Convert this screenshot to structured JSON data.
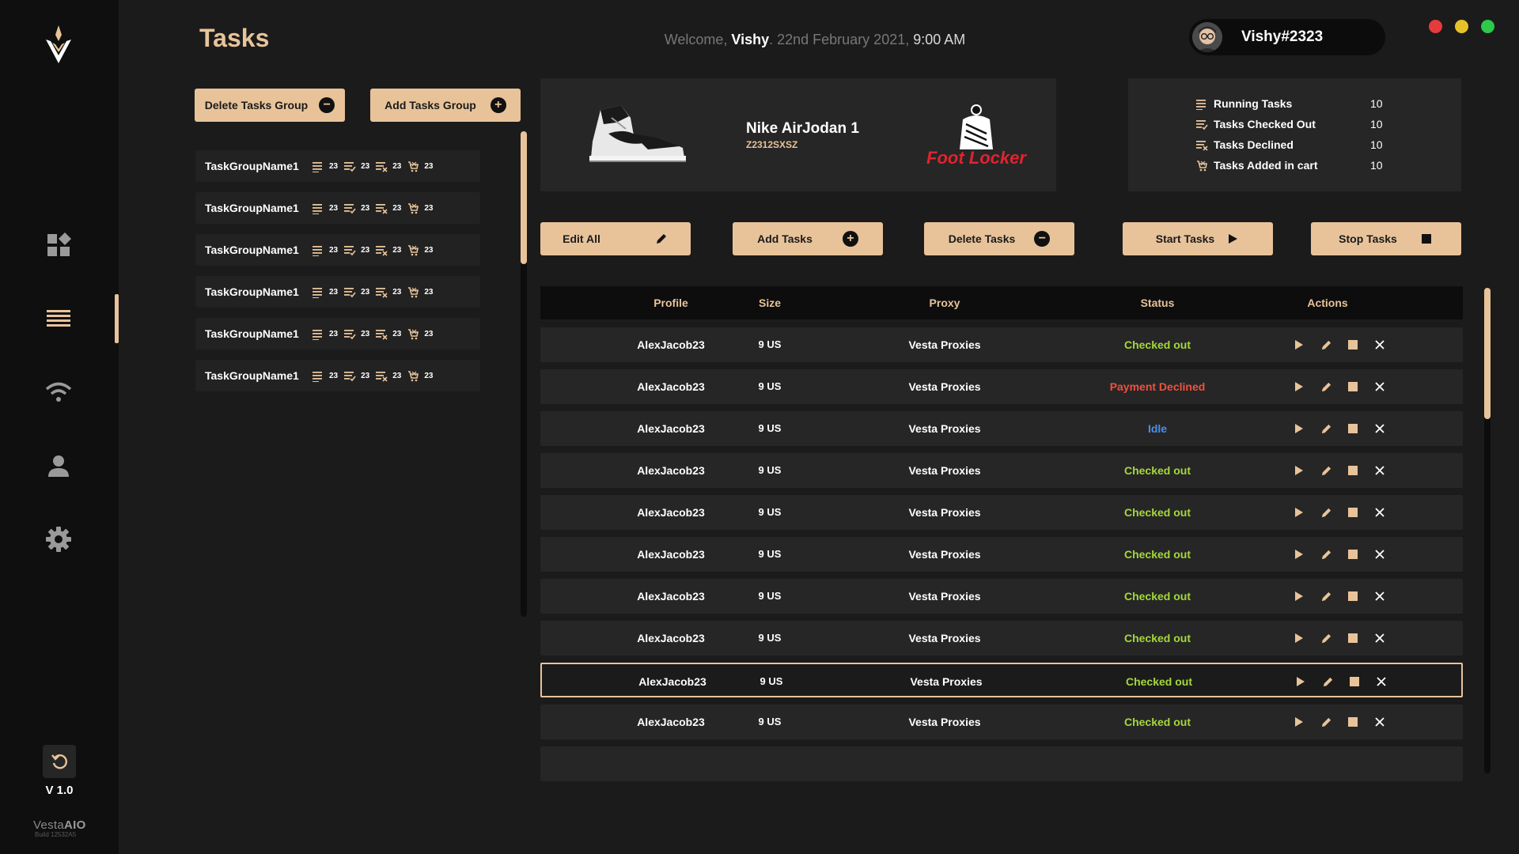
{
  "sidebar": {
    "nav": [
      "dashboard-icon",
      "tasks-icon",
      "proxies-icon",
      "profiles-icon",
      "settings-icon"
    ],
    "active": "tasks-icon",
    "version": "V 1.0",
    "brand_light": "Vesta",
    "brand_bold": "AIO",
    "build": "Build 12532A5"
  },
  "header": {
    "title": "Tasks",
    "welcome_prefix": "Welcome, ",
    "welcome_name": "Vishy",
    "welcome_date": ". 22nd February 2021, ",
    "welcome_time": "9:00 AM",
    "username": "Vishy#2323"
  },
  "window_controls": {
    "close": "#e63b3b",
    "minimize": "#e6c229",
    "maximize": "#2ec84a"
  },
  "group_buttons": {
    "delete": "Delete Tasks Group",
    "add": "Add Tasks Group"
  },
  "task_groups": [
    {
      "name": "TaskGroupName1",
      "running": "23",
      "checked": "23",
      "declined": "23",
      "cart": "23"
    },
    {
      "name": "TaskGroupName1",
      "running": "23",
      "checked": "23",
      "declined": "23",
      "cart": "23"
    },
    {
      "name": "TaskGroupName1",
      "running": "23",
      "checked": "23",
      "declined": "23",
      "cart": "23"
    },
    {
      "name": "TaskGroupName1",
      "running": "23",
      "checked": "23",
      "declined": "23",
      "cart": "23"
    },
    {
      "name": "TaskGroupName1",
      "running": "23",
      "checked": "23",
      "declined": "23",
      "cart": "23"
    },
    {
      "name": "TaskGroupName1",
      "running": "23",
      "checked": "23",
      "declined": "23",
      "cart": "23"
    }
  ],
  "product": {
    "name": "Nike AirJodan 1",
    "sku": "Z2312SXSZ",
    "store": "Foot Locker"
  },
  "stats": [
    {
      "label": "Running Tasks",
      "value": "10",
      "icon": "running-icon"
    },
    {
      "label": "Tasks Checked Out",
      "value": "10",
      "icon": "checked-icon"
    },
    {
      "label": "Tasks Declined",
      "value": "10",
      "icon": "declined-icon"
    },
    {
      "label": "Tasks Added in cart",
      "value": "10",
      "icon": "cart-icon"
    }
  ],
  "toolbar": {
    "edit_all": "Edit All",
    "add_tasks": "Add Tasks",
    "delete_tasks": "Delete Tasks",
    "start_tasks": "Start Tasks",
    "stop_tasks": "Stop Tasks"
  },
  "table": {
    "headers": {
      "profile": "Profile",
      "size": "Size",
      "proxy": "Proxy",
      "status": "Status",
      "actions": "Actions"
    },
    "rows": [
      {
        "profile": "AlexJacob23",
        "size": "9 US",
        "proxy": "Vesta Proxies",
        "status": "Checked out",
        "state": "ok"
      },
      {
        "profile": "AlexJacob23",
        "size": "9 US",
        "proxy": "Vesta Proxies",
        "status": "Payment Declined",
        "state": "dec"
      },
      {
        "profile": "AlexJacob23",
        "size": "9 US",
        "proxy": "Vesta Proxies",
        "status": "Idle",
        "state": "idle"
      },
      {
        "profile": "AlexJacob23",
        "size": "9 US",
        "proxy": "Vesta Proxies",
        "status": "Checked out",
        "state": "ok"
      },
      {
        "profile": "AlexJacob23",
        "size": "9 US",
        "proxy": "Vesta Proxies",
        "status": "Checked out",
        "state": "ok"
      },
      {
        "profile": "AlexJacob23",
        "size": "9 US",
        "proxy": "Vesta Proxies",
        "status": "Checked out",
        "state": "ok"
      },
      {
        "profile": "AlexJacob23",
        "size": "9 US",
        "proxy": "Vesta Proxies",
        "status": "Checked out",
        "state": "ok"
      },
      {
        "profile": "AlexJacob23",
        "size": "9 US",
        "proxy": "Vesta Proxies",
        "status": "Checked out",
        "state": "ok"
      },
      {
        "profile": "AlexJacob23",
        "size": "9 US",
        "proxy": "Vesta Proxies",
        "status": "Checked out",
        "state": "ok",
        "selected": true
      },
      {
        "profile": "AlexJacob23",
        "size": "9 US",
        "proxy": "Vesta Proxies",
        "status": "Checked out",
        "state": "ok"
      }
    ]
  },
  "colors": {
    "accent": "#e8c39a",
    "status_ok": "#a4d83a",
    "status_declined": "#f0503e",
    "status_idle": "#4a8ef0",
    "store_red": "#e0232e"
  }
}
